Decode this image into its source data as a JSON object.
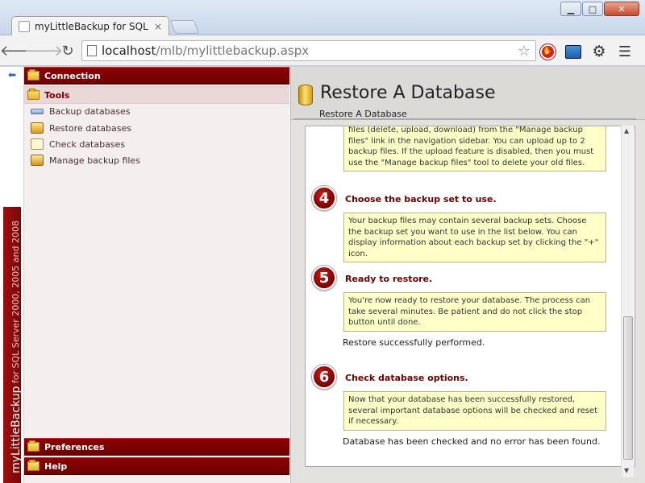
{
  "browser": {
    "tab_title": "myLittleBackup for SQL Se",
    "tab_close": "×",
    "url_host": "localhost",
    "url_path": "/mlb/mylittlebackup.aspx"
  },
  "sidebar": {
    "vertical_brand": "myLittleBackup",
    "vertical_sub": " for SQL Server 2000, 2005 and 2008",
    "sections": {
      "connection": "Connection",
      "tools": "Tools",
      "preferences": "Preferences",
      "help": "Help"
    },
    "tools": [
      {
        "label": "Backup databases",
        "icon": "backup-icon"
      },
      {
        "label": "Restore databases",
        "icon": "restore-icon"
      },
      {
        "label": "Check databases",
        "icon": "check-icon"
      },
      {
        "label": "Manage backup files",
        "icon": "manage-files-icon"
      }
    ]
  },
  "main": {
    "page_title": "Restore A Database",
    "breadcrumb": "Restore A Database",
    "top_note": "files (delete, upload, download) from the \"Manage backup files\" link in the navigation sidebar. You can upload up to 2 backup files. If the upload feature is disabled, then you must use the \"Manage backup files\" tool to delete your old files.",
    "steps": [
      {
        "number": "4",
        "title": "Choose the backup set to use.",
        "note": "Your backup files may contain several backup sets. Choose the backup set you want to use in the list below. You can display information about each backup set by clicking the \"+\" icon.",
        "status": ""
      },
      {
        "number": "5",
        "title": "Ready to restore.",
        "note": "You're now ready to restore your database. The process can take several minutes. Be patient and do not click the stop button until done.",
        "status": "Restore successfully performed."
      },
      {
        "number": "6",
        "title": "Check database options.",
        "note": "Now that your database has been successfully restored, several important database options will be checked and reset if necessary.",
        "status": "Database has been checked and no error has been found."
      }
    ]
  },
  "colors": {
    "brand_red": "#7a0000",
    "note_yellow": "#ffffc8"
  }
}
